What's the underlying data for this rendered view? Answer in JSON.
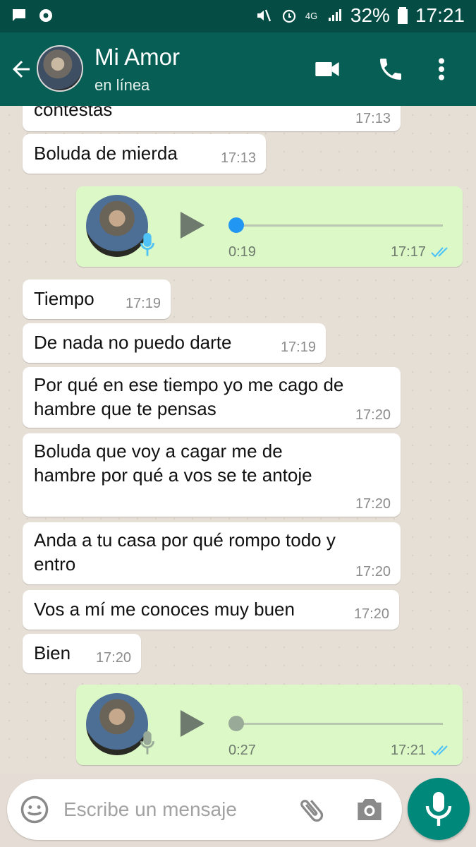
{
  "status_bar": {
    "battery_percent": "32%",
    "time": "17:21",
    "network": "4G",
    "icons": [
      "chat-notification-icon",
      "settings-notification-icon",
      "mute-icon",
      "alarm-icon",
      "network-4g-icon",
      "signal-icon",
      "battery-icon"
    ]
  },
  "header": {
    "contact_name": "Mi Amor",
    "status": "en línea",
    "icons": [
      "back-arrow-icon",
      "video-call-icon",
      "phone-icon",
      "more-vert-icon"
    ]
  },
  "messages": [
    {
      "type": "text",
      "direction": "in",
      "text": "contestas",
      "time": "17:13"
    },
    {
      "type": "text",
      "direction": "in",
      "text": "Boluda de mierda",
      "time": "17:13"
    },
    {
      "type": "voice",
      "direction": "out",
      "duration": "0:19",
      "time": "17:17",
      "played": false
    },
    {
      "type": "text",
      "direction": "in",
      "text": "Tiempo",
      "time": "17:19"
    },
    {
      "type": "text",
      "direction": "in",
      "text": "De nada no puedo darte",
      "time": "17:19"
    },
    {
      "type": "text",
      "direction": "in",
      "lines": [
        "Por qué en ese tiempo yo me cago de",
        "hambre que te pensas"
      ],
      "time": "17:20"
    },
    {
      "type": "text",
      "direction": "in",
      "lines": [
        "Boluda que voy a cagar me de",
        "hambre por qué a vos se te antoje"
      ],
      "time": "17:20"
    },
    {
      "type": "text",
      "direction": "in",
      "lines": [
        "Anda a tu casa por qué rompo todo y",
        "entro"
      ],
      "time": "17:20"
    },
    {
      "type": "text",
      "direction": "in",
      "text": "Vos a mí me conoces muy buen",
      "time": "17:20"
    },
    {
      "type": "text",
      "direction": "in",
      "text": "Bien",
      "time": "17:20"
    },
    {
      "type": "voice",
      "direction": "out",
      "duration": "0:27",
      "time": "17:21",
      "played": true
    }
  ],
  "composer": {
    "placeholder": "Escribe un mensaje",
    "value": ""
  },
  "colors": {
    "header": "#075e54",
    "status_bar": "#054d44",
    "outgoing_bubble": "#dcf8c6",
    "incoming_bubble": "#ffffff",
    "read_ticks": "#4fc3f7",
    "unplayed_knob": "#2196f3",
    "played_knob": "#9aaa98",
    "fab": "#00897b"
  }
}
